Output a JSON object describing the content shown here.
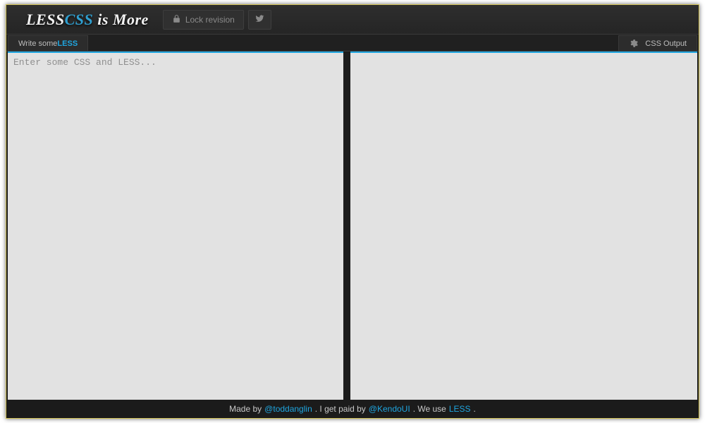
{
  "colors": {
    "accent": "#1fa6e0",
    "bg_dark": "#1b1b1b",
    "pane_bg": "#e2e2e2"
  },
  "header": {
    "logo_prefix": "LESS",
    "logo_mid": "CSS",
    "logo_suffix": " is More",
    "lock_label": "Lock revision"
  },
  "tabs": {
    "left_prefix": "Write some ",
    "left_accent": "LESS",
    "right_label": "CSS Output"
  },
  "editor": {
    "placeholder": "Enter some CSS and LESS...",
    "value": ""
  },
  "output": {
    "value": ""
  },
  "footer": {
    "t1": "Made by ",
    "link1": "@toddanglin",
    "t2": ". I get paid by ",
    "link2": "@KendoUI",
    "t3": ". We use ",
    "link3": "LESS",
    "t4": "."
  }
}
